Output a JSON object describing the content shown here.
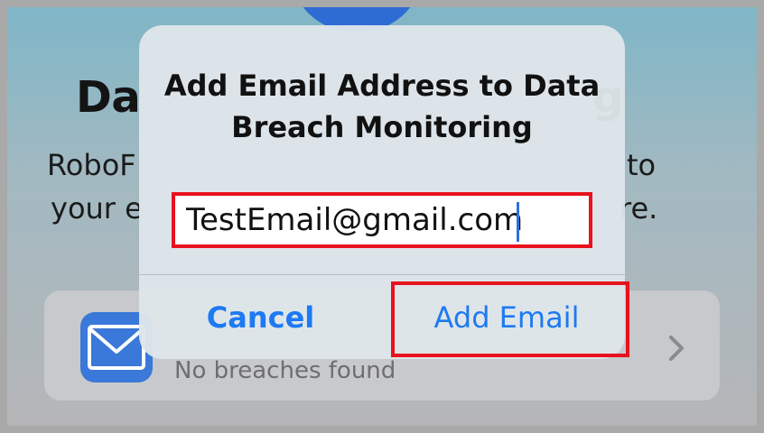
{
  "background": {
    "heading_left": "Da",
    "heading_right": "g",
    "description_line1_left": "RoboF",
    "description_line1_right": "to",
    "description_line2_left": "your e",
    "description_line2_right": "re.",
    "breach_card": {
      "icon": "mail-icon",
      "status": "No breaches found",
      "chevron": "chevron-right-icon"
    }
  },
  "dialog": {
    "title": "Add Email Address to Data Breach Monitoring",
    "email_value": "TestEmail@gmail.com",
    "cancel_label": "Cancel",
    "add_label": "Add Email"
  },
  "colors": {
    "accent_blue": "#1d7af2",
    "highlight_red": "#e8121d",
    "mail_tile": "#3a78d9"
  }
}
